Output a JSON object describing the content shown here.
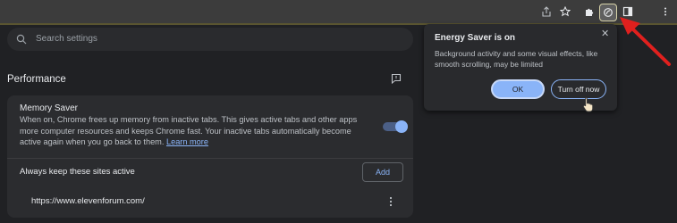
{
  "search": {
    "placeholder": "Search settings"
  },
  "section": {
    "title": "Performance"
  },
  "memory_saver": {
    "title": "Memory Saver",
    "description": "When on, Chrome frees up memory from inactive tabs. This gives active tabs and other apps more computer resources and keeps Chrome fast. Your inactive tabs automatically become active again when you go back to them.",
    "learn_more": "Learn more",
    "toggle_on": true
  },
  "always_active": {
    "label": "Always keep these sites active",
    "add_label": "Add",
    "sites": [
      "https://www.elevenforum.com/"
    ]
  },
  "popup": {
    "title": "Energy Saver is on",
    "body": "Background activity and some visual effects, like smooth scrolling, may be limited",
    "ok_label": "OK",
    "turnoff_label": "Turn off now"
  },
  "toolbar": {
    "icons": [
      "share-icon",
      "bookmark-star-icon",
      "extensions-icon",
      "energy-saver-icon",
      "side-panel-icon",
      "more-menu-icon"
    ]
  },
  "colors": {
    "accent": "#8ab4f8",
    "annotation_arrow": "#e0201e"
  }
}
